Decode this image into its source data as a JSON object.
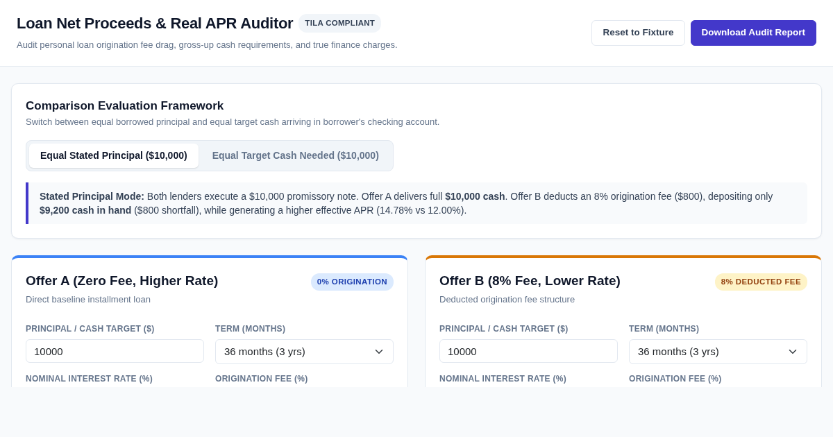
{
  "header": {
    "title": "Loan Net Proceeds & Real APR Auditor",
    "badge": "TILA COMPLIANT",
    "subtitle": "Audit personal loan origination fee drag, gross-up cash requirements, and true finance charges.",
    "buttons": [
      {
        "label": "Reset to Fixture",
        "kind": "outline"
      },
      {
        "label": "Download Audit Report",
        "kind": "primary"
      }
    ]
  },
  "framework": {
    "title": "Comparison Evaluation Framework",
    "subtitle": "Switch between equal borrowed principal and equal target cash arriving in borrower's checking account.",
    "tabs": [
      {
        "label": "Equal Stated Principal ($10,000)",
        "selected": true
      },
      {
        "label": "Equal Target Cash Needed ($10,000)",
        "selected": false
      }
    ],
    "note": "**Stated Principal Mode:** Both lenders execute a $10,000 promissory note. Offer A delivers full **$10,000 cash**. Offer B deducts an 8% origination fee ($800), depositing only **$9,200 cash in hand** ($800 shortfall), while generating a higher effective APR (14.78% vs 12.00%)."
  },
  "offers": [
    {
      "title": "Offer A (Zero Fee, Higher Rate)",
      "subtitle": "Direct baseline installment loan",
      "badge": "0% ORIGINATION",
      "color": "#3b82f6",
      "fields": [
        {
          "label": "PRINCIPAL / CASH TARGET ($)",
          "kind": "input",
          "value": "10000"
        },
        {
          "label": "TERM (MONTHS)",
          "kind": "select",
          "value": "36 months (3 yrs)"
        },
        {
          "label": "NOMINAL INTEREST RATE (%)",
          "kind": "label"
        },
        {
          "label": "ORIGINATION FEE (%)",
          "kind": "label"
        }
      ]
    },
    {
      "title": "Offer B (8% Fee, Lower Rate)",
      "subtitle": "Deducted origination fee structure",
      "badge": "8% DEDUCTED FEE",
      "color": "#d97706",
      "fields": [
        {
          "label": "PRINCIPAL / CASH TARGET ($)",
          "kind": "input",
          "value": "10000"
        },
        {
          "label": "TERM (MONTHS)",
          "kind": "select",
          "value": "36 months (3 yrs)"
        },
        {
          "label": "NOMINAL INTEREST RATE (%)",
          "kind": "label"
        },
        {
          "label": "ORIGINATION FEE (%)",
          "kind": "label"
        }
      ]
    }
  ]
}
